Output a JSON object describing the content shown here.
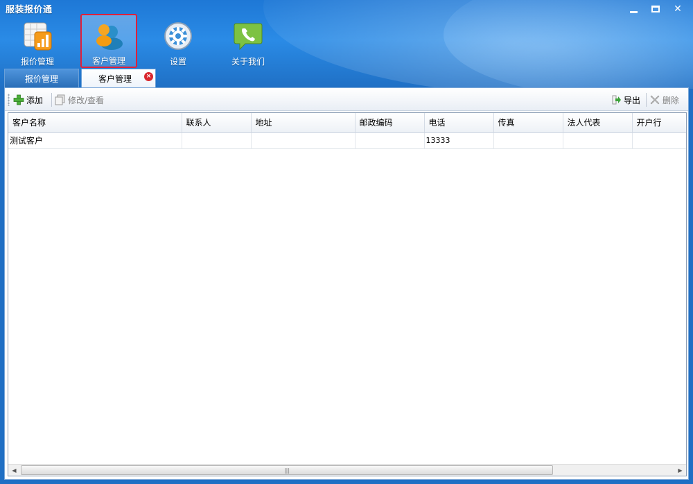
{
  "app": {
    "title": "服装报价通"
  },
  "nav": {
    "items": [
      {
        "label": "报价管理",
        "icon": "chart-icon"
      },
      {
        "label": "客户管理",
        "icon": "customer-icon"
      },
      {
        "label": "设置",
        "icon": "gear-icon"
      },
      {
        "label": "关于我们",
        "icon": "phone-bubble-icon"
      }
    ],
    "active_index": 1
  },
  "tabs": [
    {
      "label": "报价管理",
      "selected": false
    },
    {
      "label": "客户管理",
      "selected": true
    }
  ],
  "toolbar": {
    "add_label": "添加",
    "edit_label": "修改/查看",
    "export_label": "导出",
    "delete_label": "删除"
  },
  "table": {
    "columns": [
      "客户名称",
      "联系人",
      "地址",
      "邮政编码",
      "电话",
      "传真",
      "法人代表",
      "开户行"
    ],
    "rows": [
      [
        "测试客户",
        "",
        "",
        "",
        "13333",
        "",
        "",
        ""
      ]
    ]
  },
  "colors": {
    "accent_blue": "#1f6fc4",
    "active_outline": "#e0203a",
    "close_red": "#d9262e"
  }
}
